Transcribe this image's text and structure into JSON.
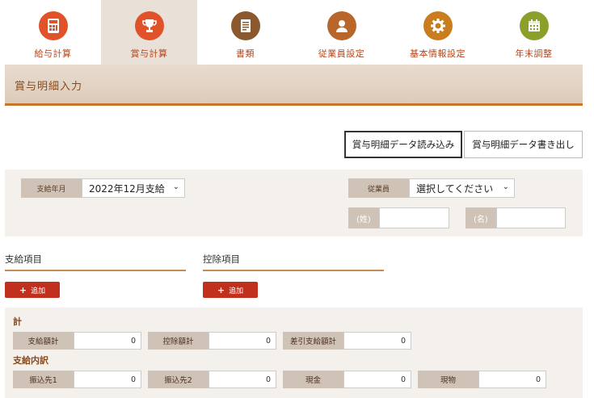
{
  "nav": {
    "tabs": [
      {
        "label": "給与計算",
        "icon": "calculator-icon",
        "color": "#e0532a"
      },
      {
        "label": "賞与計算",
        "icon": "trophy-icon",
        "color": "#e0532a"
      },
      {
        "label": "書類",
        "icon": "document-icon",
        "color": "#8a5a2e"
      },
      {
        "label": "従業員設定",
        "icon": "user-icon",
        "color": "#b9662a"
      },
      {
        "label": "基本情報設定",
        "icon": "gear-icon",
        "color": "#c97d1e"
      },
      {
        "label": "年末調整",
        "icon": "calendar-icon",
        "color": "#8aa02a"
      }
    ],
    "active_index": 1
  },
  "header": {
    "title": "賞与明細入力"
  },
  "actions": {
    "read_label": "賞与明細データ読み込み",
    "write_label": "賞与明細データ書き出し"
  },
  "filter": {
    "pay_month_label": "支給年月",
    "pay_month_value": "2022年12月支給",
    "employee_label": "従業員",
    "employee_value": "選択してください",
    "last_name_label": "(姓)",
    "first_name_label": "(名)"
  },
  "sections": {
    "payment_title": "支給項目",
    "deduction_title": "控除項目",
    "add_label": "追加"
  },
  "totals": {
    "heading": "計",
    "items": [
      {
        "label": "支給額計",
        "value": "0"
      },
      {
        "label": "控除額計",
        "value": "0"
      },
      {
        "label": "差引支給額計",
        "value": "0"
      }
    ],
    "breakdown_heading": "支給内訳",
    "breakdown": [
      {
        "label": "振込先1",
        "value": "0"
      },
      {
        "label": "振込先2",
        "value": "0"
      },
      {
        "label": "現金",
        "value": "0"
      },
      {
        "label": "現物",
        "value": "0"
      }
    ]
  },
  "colors": {
    "accent": "#c0301c",
    "brand": "#b5451b",
    "border": "#c6762a"
  }
}
